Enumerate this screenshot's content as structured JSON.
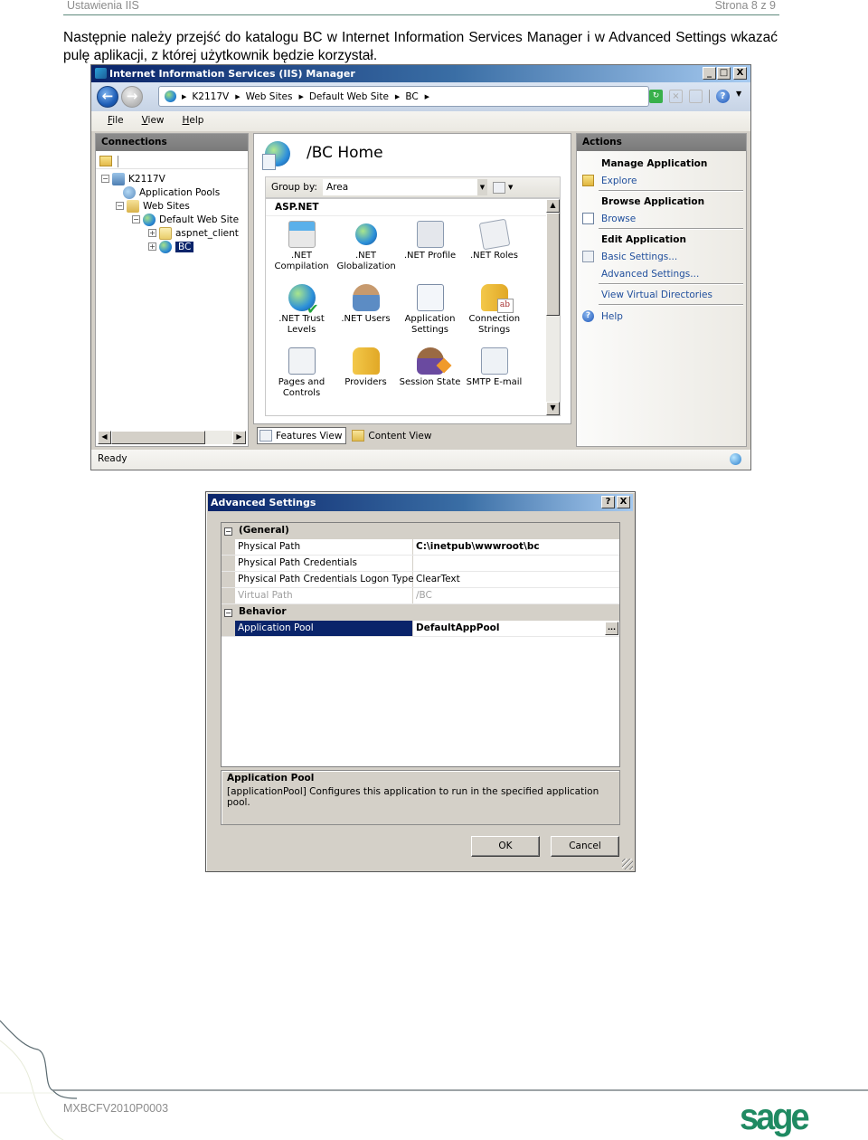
{
  "document": {
    "header_left": "Ustawienia IIS",
    "header_right": "Strona 8 z 9",
    "intro_text": "Następnie należy przejść do katalogu BC w Internet Information Services Manager i w Advanced Settings wkazać pulę aplikacji, z której użytkownik będzie korzystał.",
    "footer_code": "MXBCFV2010P0003",
    "logo_text": "sage",
    "brand_color": "#1f8a62"
  },
  "iis_window": {
    "title": "Internet Information Services (IIS) Manager",
    "window_buttons": {
      "minimize": "_",
      "maximize": "□",
      "close": "X"
    },
    "navigation": {
      "back_icon": "back-arrow-icon",
      "forward_icon": "forward-arrow-icon",
      "breadcrumb": [
        "K2117V",
        "Web Sites",
        "Default Web Site",
        "BC"
      ],
      "tools": [
        "refresh-icon",
        "stop-icon",
        "home-icon",
        "help-icon"
      ]
    },
    "menu": [
      "File",
      "View",
      "Help"
    ],
    "connections": {
      "title": "Connections",
      "tree": [
        {
          "label": "K2117V",
          "icon": "server-icon",
          "level": 0,
          "expander": "−"
        },
        {
          "label": "Application Pools",
          "icon": "app-pools-icon",
          "level": 1,
          "expander": ""
        },
        {
          "label": "Web Sites",
          "icon": "web-sites-icon",
          "level": 1,
          "expander": "−"
        },
        {
          "label": "Default Web Site",
          "icon": "globe-icon",
          "level": 2,
          "expander": "−"
        },
        {
          "label": "aspnet_client",
          "icon": "folder-icon",
          "level": 3,
          "expander": "+"
        },
        {
          "label": "BC",
          "icon": "application-icon",
          "level": 3,
          "expander": "+",
          "selected": true
        }
      ]
    },
    "center": {
      "title": "/BC Home",
      "group_by_label": "Group by:",
      "group_by_value": "Area",
      "group_title": "ASP.NET",
      "features": [
        {
          "label": ".NET Compilation",
          "icon": "net-compilation-icon"
        },
        {
          "label": ".NET Globalization",
          "icon": "net-globalization-icon"
        },
        {
          "label": ".NET Profile",
          "icon": "net-profile-icon"
        },
        {
          "label": ".NET Roles",
          "icon": "net-roles-icon"
        },
        {
          "label": ".NET Trust Levels",
          "icon": "net-trust-levels-icon"
        },
        {
          "label": ".NET Users",
          "icon": "net-users-icon"
        },
        {
          "label": "Application Settings",
          "icon": "application-settings-icon"
        },
        {
          "label": "Connection Strings",
          "icon": "connection-strings-icon"
        },
        {
          "label": "Pages and Controls",
          "icon": "pages-controls-icon"
        },
        {
          "label": "Providers",
          "icon": "providers-icon"
        },
        {
          "label": "Session State",
          "icon": "session-state-icon"
        },
        {
          "label": "SMTP E-mail",
          "icon": "smtp-email-icon"
        }
      ],
      "view_tabs": [
        {
          "label": "Features View",
          "active": true
        },
        {
          "label": "Content View",
          "active": false
        }
      ]
    },
    "actions": {
      "title": "Actions",
      "groups": [
        {
          "title": "Manage Application",
          "links": [
            {
              "label": "Explore",
              "icon": "explore-icon"
            }
          ]
        },
        {
          "title": "Browse Application",
          "links": [
            {
              "label": "Browse",
              "icon": "browse-icon"
            }
          ]
        },
        {
          "title": "Edit Application",
          "links": [
            {
              "label": "Basic Settings...",
              "icon": "basic-settings-icon"
            },
            {
              "label": "Advanced Settings...",
              "icon": ""
            }
          ]
        },
        {
          "title": "",
          "links": [
            {
              "label": "View Virtual Directories",
              "icon": ""
            }
          ]
        },
        {
          "title": "",
          "links": [
            {
              "label": "Help",
              "icon": "help-icon"
            }
          ]
        }
      ]
    },
    "status": "Ready"
  },
  "advanced_settings": {
    "title": "Advanced Settings",
    "title_buttons": {
      "help": "?",
      "close": "X"
    },
    "categories": [
      {
        "name": "(General)",
        "expander": "−",
        "properties": [
          {
            "name": "Physical Path",
            "value": "C:\\inetpub\\wwwroot\\bc"
          },
          {
            "name": "Physical Path Credentials",
            "value": ""
          },
          {
            "name": "Physical Path Credentials Logon Type",
            "value": "ClearText"
          },
          {
            "name": "Virtual Path",
            "value": "/BC"
          }
        ]
      },
      {
        "name": "Behavior",
        "expander": "−",
        "properties": [
          {
            "name": "Application Pool",
            "value": "DefaultAppPool"
          }
        ]
      }
    ],
    "ellipsis_label": "...",
    "description_title": "Application Pool",
    "description_text": "[applicationPool] Configures this application to run in the specified application pool.",
    "ok_label": "OK",
    "cancel_label": "Cancel"
  }
}
